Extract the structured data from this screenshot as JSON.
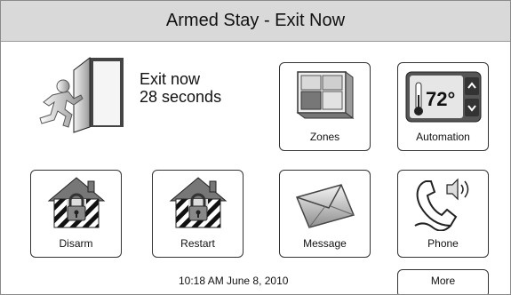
{
  "status": {
    "title": "Armed Stay - Exit Now"
  },
  "exit": {
    "line1": "Exit now",
    "line2": "28 seconds",
    "icon": "exit-door-icon"
  },
  "tiles": {
    "zones": {
      "label": "Zones",
      "icon": "zones-icon"
    },
    "automation": {
      "label": "Automation",
      "icon": "thermostat-icon",
      "temperature": "72°"
    },
    "disarm": {
      "label": "Disarm",
      "icon": "house-lock-icon"
    },
    "restart": {
      "label": "Restart",
      "icon": "house-lock-icon"
    },
    "message": {
      "label": "Message",
      "icon": "envelope-icon"
    },
    "phone": {
      "label": "Phone",
      "icon": "phone-icon"
    },
    "more": {
      "label": "More"
    }
  },
  "footer": {
    "datetime": "10:18 AM June 8, 2010"
  },
  "colors": {
    "titlebar": "#d9d9d9",
    "tile_border": "#333333"
  }
}
